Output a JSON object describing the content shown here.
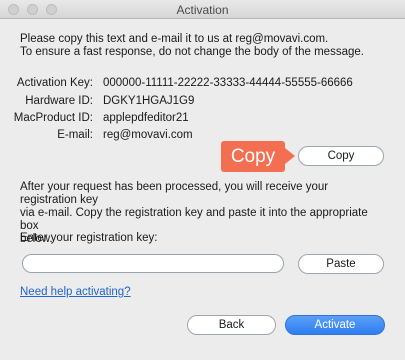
{
  "window": {
    "title": "Activation"
  },
  "intro": {
    "line1": "Please copy this text and e-mail it to us at reg@movavi.com.",
    "line2": "To ensure a fast response, do not change the body of the message."
  },
  "info": [
    {
      "label": "Activation Key:",
      "value": "000000-11111-22222-33333-44444-55555-66666"
    },
    {
      "label": "Hardware ID:",
      "value": "DGKY1HGAJ1G9"
    },
    {
      "label": "MacProduct ID:",
      "value": "applepdfeditor21"
    },
    {
      "label": "E-mail:",
      "value": "reg@movavi.com"
    }
  ],
  "callout": {
    "text": "Copy",
    "color": "#f26f52"
  },
  "buttons": {
    "copy": "Copy",
    "paste": "Paste",
    "back": "Back",
    "activate": "Activate"
  },
  "instructions": {
    "line1": "After your request has been processed, you will receive your registration key",
    "line2": "via e-mail. Copy the registration key and paste it into the appropriate box",
    "line3": "below."
  },
  "registration": {
    "label": "Enter your registration key:",
    "value": "",
    "placeholder": ""
  },
  "help_link": "Need help activating?",
  "colors": {
    "accent": "#2f7ef1",
    "link": "#2463c9"
  }
}
